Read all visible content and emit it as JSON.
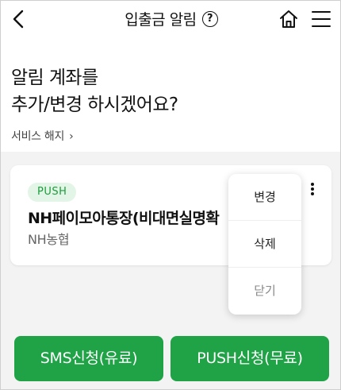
{
  "header": {
    "title": "입출금 알림",
    "help_symbol": "?",
    "icons": [
      "back-arrow-icon",
      "help-icon",
      "home-icon",
      "menu-icon"
    ]
  },
  "headline": {
    "line1": "알림 계좌를",
    "line2": "추가/변경 하시겠어요?"
  },
  "cancel_service": {
    "label": "서비스 해지",
    "chevron": "›"
  },
  "account_card": {
    "badge": "PUSH",
    "account_name": "NH페이모아통장(비대면실명확",
    "bank": "NH농협"
  },
  "context_menu": {
    "items": [
      "변경",
      "삭제",
      "닫기"
    ]
  },
  "buttons": {
    "sms": "SMS신청(유료)",
    "push": "PUSH신청(무료)"
  },
  "colors": {
    "accent_green": "#1fa346",
    "badge_bg": "#e2f5e6",
    "badge_text": "#1a9d3a",
    "background": "#f3f3f3"
  }
}
